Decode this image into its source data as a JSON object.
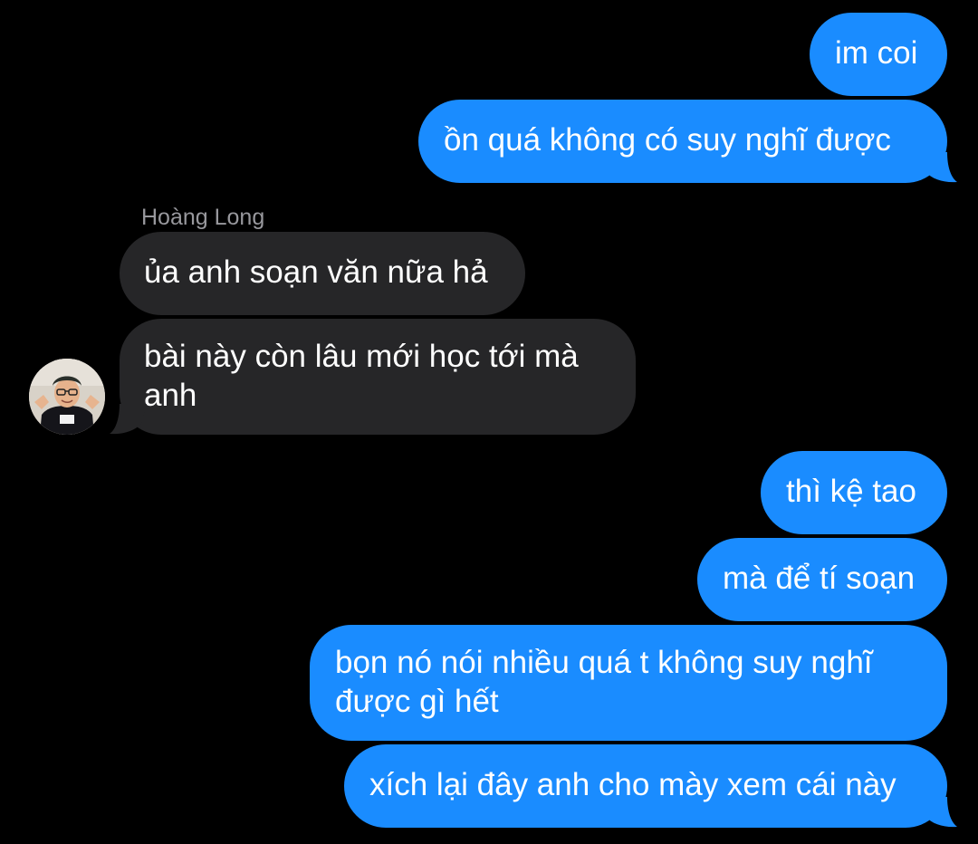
{
  "conversation": {
    "contact_name": "Hoàng Long",
    "messages": [
      {
        "direction": "sent",
        "text": "im coi"
      },
      {
        "direction": "sent",
        "text": "ồn quá không có suy nghĩ được"
      },
      {
        "direction": "received",
        "text": "ủa anh soạn văn nữa hả"
      },
      {
        "direction": "received",
        "text": "bài này còn lâu mới học tới mà anh"
      },
      {
        "direction": "sent",
        "text": "thì kệ tao"
      },
      {
        "direction": "sent",
        "text": "mà để tí soạn"
      },
      {
        "direction": "sent",
        "text": "bọn nó nói nhiều quá t không suy nghĩ được gì hết"
      },
      {
        "direction": "sent",
        "text": "xích lại đây anh cho mày xem cái này"
      }
    ]
  },
  "colors": {
    "background": "#000000",
    "sent_bubble": "#1a8cff",
    "received_bubble": "#262628",
    "message_text": "#ffffff",
    "sender_name_text": "#98989d"
  },
  "icons": {
    "avatar": "contact-avatar-photo"
  }
}
